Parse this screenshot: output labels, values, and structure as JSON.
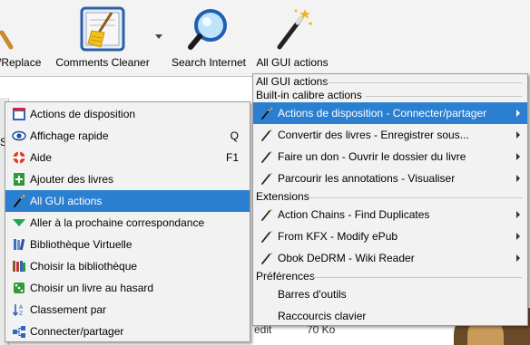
{
  "toolbar": {
    "buttons": [
      {
        "label": "/Replace",
        "icon": "broom-partial-icon"
      },
      {
        "label": "Comments Cleaner",
        "icon": "broom-icon"
      },
      {
        "label": "Search Internet",
        "icon": "magnifier-icon"
      },
      {
        "label": "All GUI actions",
        "icon": "magic-wand-icon"
      }
    ]
  },
  "background": {
    "peek_letter": "S",
    "footer_label": "edit",
    "footer_size": "70 Ko"
  },
  "left_menu": {
    "items": [
      {
        "label": "Actions de disposition",
        "shortcut": "",
        "icon": "layout-icon",
        "color": "#2c64c0"
      },
      {
        "label": "Affichage rapide",
        "shortcut": "Q",
        "icon": "eye-icon",
        "color": "#1f4fa0"
      },
      {
        "label": "Aide",
        "shortcut": "F1",
        "icon": "lifebuoy-icon",
        "color": "#e03a2a"
      },
      {
        "label": "Ajouter des livres",
        "shortcut": "",
        "icon": "add-book-icon",
        "color": "#2e9a3a"
      },
      {
        "label": "All GUI actions",
        "shortcut": "",
        "icon": "magic-wand-icon",
        "color": "#ffffff",
        "selected": true
      },
      {
        "label": "Aller à la prochaine correspondance",
        "shortcut": "",
        "icon": "green-arrow-down-icon",
        "color": "#1fa84a"
      },
      {
        "label": "Bibliothèque Virtuelle",
        "shortcut": "",
        "icon": "books-icon",
        "color": "#3a6fc8"
      },
      {
        "label": "Choisir la bibliothèque",
        "shortcut": "",
        "icon": "library-icon",
        "color": "#8b5a2b"
      },
      {
        "label": "Choisir un livre au hasard",
        "shortcut": "",
        "icon": "dice-icon",
        "color": "#2e9a3a"
      },
      {
        "label": "Classement par",
        "shortcut": "",
        "icon": "sort-az-icon",
        "color": "#2c64c0"
      },
      {
        "label": "Connecter/partager",
        "shortcut": "",
        "icon": "connect-share-icon",
        "color": "#2c64c0"
      }
    ]
  },
  "right_menu": {
    "header_title": "All GUI actions",
    "section_builtin": "Built-in calibre actions",
    "builtin_items": [
      {
        "label": "Actions de disposition - Connecter/partager",
        "selected": true
      },
      {
        "label": "Convertir des livres - Enregistrer sous..."
      },
      {
        "label": "Faire un don - Ouvrir le dossier du livre"
      },
      {
        "label": "Parcourir les annotations - Visualiser"
      }
    ],
    "section_extensions": "Extensions",
    "extension_items": [
      {
        "label": "Action Chains - Find Duplicates"
      },
      {
        "label": "From KFX - Modify ePub"
      },
      {
        "label": "Obok DeDRM - Wiki Reader"
      }
    ],
    "section_preferences": "Préférences",
    "preference_items": [
      {
        "label": "Barres d'outils"
      },
      {
        "label": "Raccourcis clavier"
      }
    ]
  }
}
